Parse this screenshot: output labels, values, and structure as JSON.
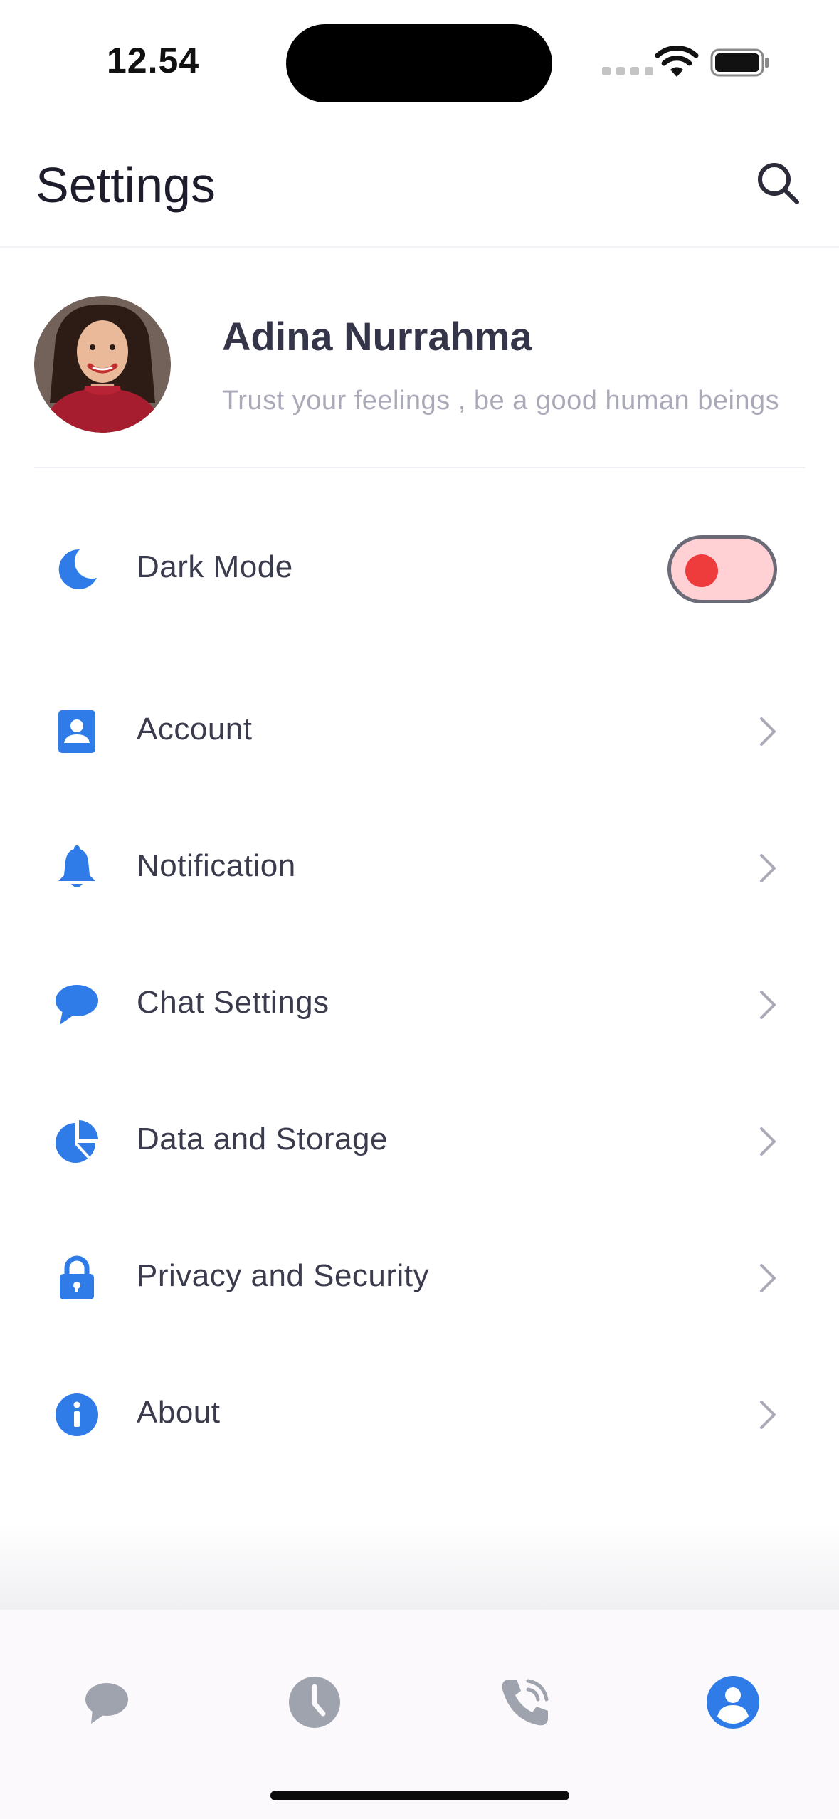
{
  "status_bar": {
    "time": "12.54"
  },
  "header": {
    "title": "Settings",
    "search_icon": "search-icon"
  },
  "profile": {
    "name": "Adina Nurrahma",
    "status": "Trust your feelings , be a good human beings"
  },
  "dark_mode": {
    "label": "Dark Mode",
    "enabled": false,
    "icon": "moon-icon"
  },
  "menu": [
    {
      "label": "Account",
      "icon": "account-icon"
    },
    {
      "label": "Notification",
      "icon": "bell-icon"
    },
    {
      "label": "Chat Settings",
      "icon": "chat-bubble-icon"
    },
    {
      "label": "Data and Storage",
      "icon": "pie-chart-icon"
    },
    {
      "label": "Privacy and Security",
      "icon": "lock-icon"
    },
    {
      "label": "About",
      "icon": "info-icon"
    }
  ],
  "bottom_nav": [
    {
      "name": "chats",
      "icon": "chat-bubble-icon",
      "active": false
    },
    {
      "name": "status",
      "icon": "clock-icon",
      "active": false
    },
    {
      "name": "calls",
      "icon": "phone-icon",
      "active": false
    },
    {
      "name": "profile",
      "icon": "user-icon",
      "active": true
    }
  ],
  "colors": {
    "accent": "#2F7CE8",
    "inactive_icon": "#9EA3AE",
    "toggle_track": "#FFD0D4",
    "toggle_knob": "#EE3B3B",
    "nav_background": "#FCF9FD"
  }
}
